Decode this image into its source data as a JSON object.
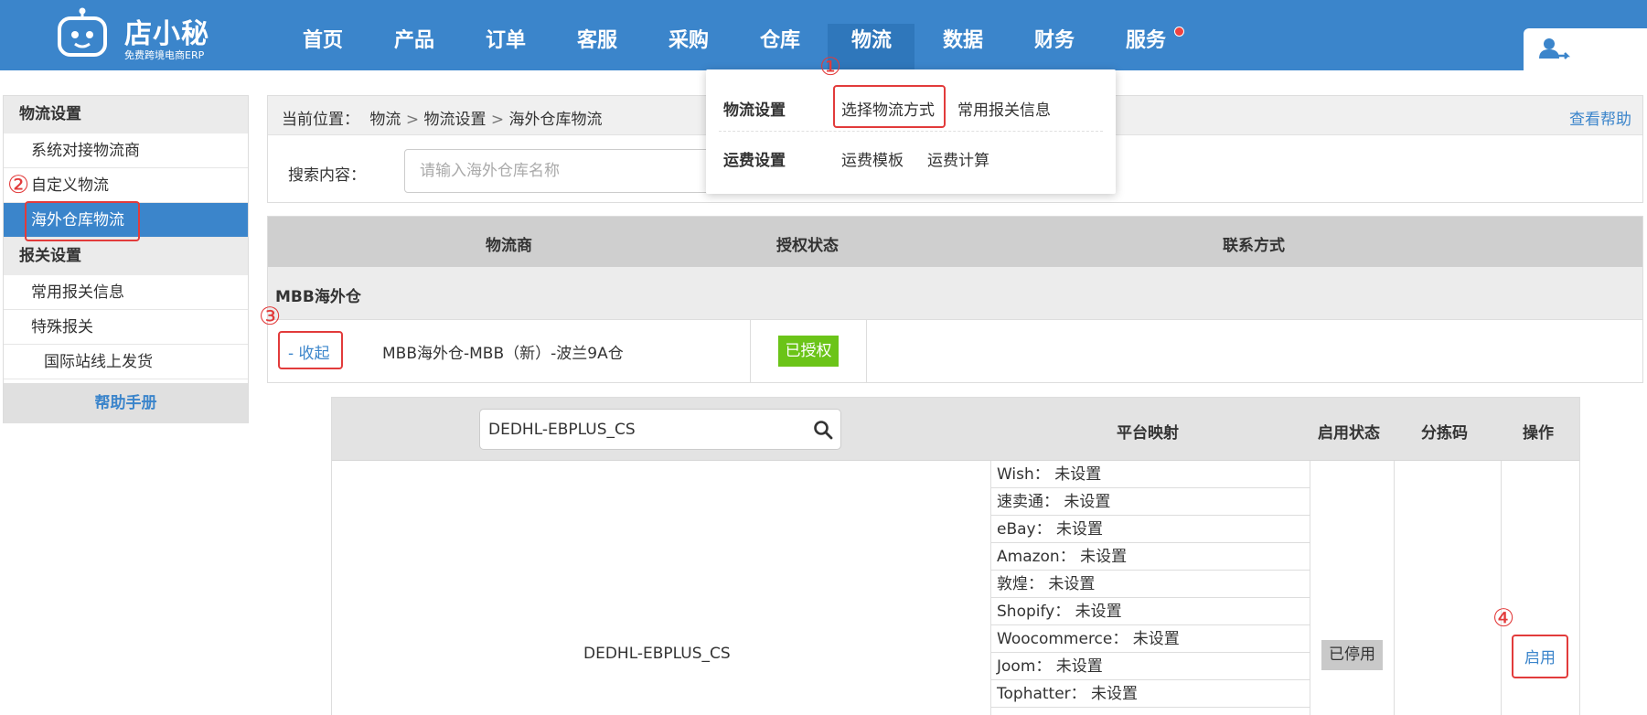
{
  "app": {
    "logo_title": "店小秘",
    "logo_subtitle": "免费跨境电商ERP"
  },
  "nav": {
    "items": [
      "首页",
      "产品",
      "订单",
      "客服",
      "采购",
      "仓库",
      "物流",
      "数据",
      "财务",
      "服务"
    ],
    "active": "物流"
  },
  "dropdown": {
    "group1_label": "物流设置",
    "group1_items": [
      "选择物流方式",
      "常用报关信息"
    ],
    "group2_label": "运费设置",
    "group2_items": [
      "运费模板",
      "运费计算"
    ]
  },
  "sidebar": {
    "section1": "物流设置",
    "section1_items": [
      "系统对接物流商",
      "自定义物流",
      "海外仓库物流"
    ],
    "section2": "报关设置",
    "section2_items": [
      "常用报关信息",
      "特殊报关"
    ],
    "sub_item": "国际站线上发货",
    "help": "帮助手册"
  },
  "breadcrumb": {
    "prefix": "当前位置：",
    "path": [
      "物流",
      "物流设置",
      "海外仓库物流"
    ],
    "help_link": "查看帮助"
  },
  "search": {
    "label": "搜索内容：",
    "placeholder": "请输入海外仓库名称"
  },
  "carrier_table": {
    "headers": [
      "物流商",
      "授权状态",
      "联系方式"
    ],
    "group": "MBB海外仓",
    "row": {
      "toggle": "- 收起",
      "name": "MBB海外仓-MBB（新）-波兰9A仓",
      "status": "已授权"
    }
  },
  "service_table": {
    "search_value": "DEDHL-EBPLUS_CS",
    "headers": [
      "平台映射",
      "启用状态",
      "分拣码",
      "操作"
    ],
    "service_name": "DEDHL-EBPLUS_CS",
    "platforms": [
      "Wish：  未设置",
      "速卖通：  未设置",
      "eBay：  未设置",
      "Amazon：  未设置",
      "敦煌：  未设置",
      "Shopify：  未设置",
      "Woocommerce：  未设置",
      "Joom：  未设置",
      "Tophatter：  未设置"
    ],
    "status": "已停用",
    "action": "启用"
  },
  "annotations": [
    "①",
    "②",
    "③",
    "④"
  ],
  "colors": {
    "brand_blue": "#3b85cb",
    "authorized_green": "#6bc418",
    "annotation_red": "#e23b3b",
    "notification_dot": "#f0423f"
  }
}
